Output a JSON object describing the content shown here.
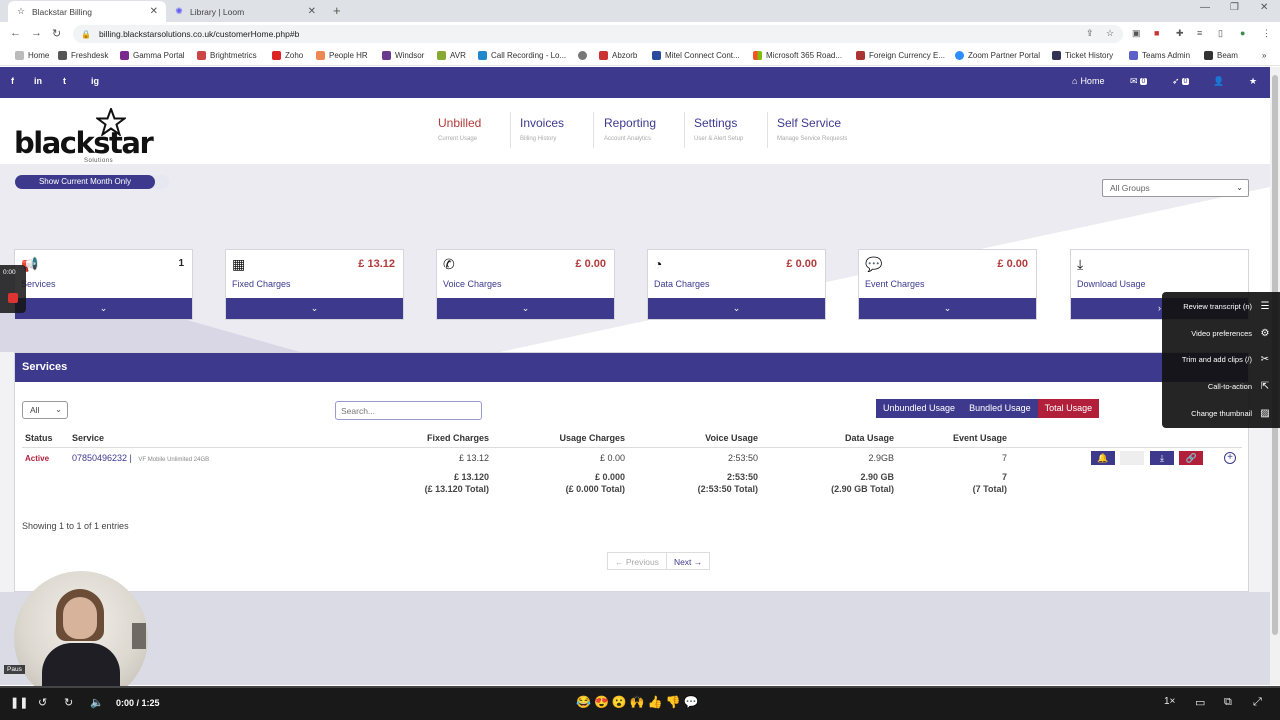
{
  "browser": {
    "tabs": [
      {
        "title": "Blackstar Billing",
        "active": true
      },
      {
        "title": "Library | Loom",
        "active": false
      }
    ],
    "url": "billing.blackstarsolutions.co.uk/customerHome.php#b",
    "bookmarks": [
      "Home",
      "Freshdesk",
      "Gamma Portal",
      "Brightmetrics",
      "Zoho",
      "People HR",
      "Windsor",
      "AVR",
      "Call Recording - Lo...",
      "Abzorb",
      "Mitel Connect Cont...",
      "Microsoft 365 Road...",
      "Foreign Currency E...",
      "Zoom Partner Portal",
      "Ticket History",
      "Teams Admin",
      "Beam"
    ]
  },
  "site": {
    "social": [
      "f",
      "in",
      "t",
      "ig"
    ],
    "top_right": {
      "home": "Home",
      "mail_count": "0",
      "rocket_count": "0"
    },
    "logo": {
      "name": "blackstar",
      "sub": "Solutions"
    },
    "nav": [
      {
        "label": "Unbilled",
        "sub": "Current Usage"
      },
      {
        "label": "Invoices",
        "sub": "Billing History"
      },
      {
        "label": "Reporting",
        "sub": "Account Analytics"
      },
      {
        "label": "Settings",
        "sub": "User & Alert Setup"
      },
      {
        "label": "Self Service",
        "sub": "Manage Service Requests"
      }
    ],
    "month_toggle": "Show Current Month Only",
    "groups_select": "All Groups",
    "cards": [
      {
        "label": "Services",
        "value": "1"
      },
      {
        "label": "Fixed Charges",
        "value": "£ 13.12"
      },
      {
        "label": "Voice Charges",
        "value": "£ 0.00"
      },
      {
        "label": "Data Charges",
        "value": "£ 0.00"
      },
      {
        "label": "Event Charges",
        "value": "£ 0.00"
      },
      {
        "label": "Download Usage",
        "value": ""
      }
    ],
    "services": {
      "title": "Services",
      "status_filter": "All",
      "search_placeholder": "Search...",
      "usage_toggle": [
        "Unbundled Usage",
        "Bundled Usage",
        "Total Usage"
      ],
      "usage_selected": "Total Usage",
      "columns": [
        "Status",
        "Service",
        "Fixed Charges",
        "Usage Charges",
        "Voice Usage",
        "Data Usage",
        "Event Usage"
      ],
      "rows": [
        {
          "status": "Active",
          "number": "07850496232 |",
          "desc": "VF Mobile Unlimited 24GB",
          "fixed": "£ 13.12",
          "usage": "£ 0.00",
          "voice": "2:53:50",
          "data": "2.9GB",
          "event": "7"
        }
      ],
      "totals": {
        "fixed": "£ 13.120",
        "fixed_total": "(£ 13.120 Total)",
        "usage": "£ 0.000",
        "usage_total": "(£ 0.000 Total)",
        "voice": "2:53:50",
        "voice_total": "(2:53:50 Total)",
        "data": "2.90 GB",
        "data_total": "(2.90 GB Total)",
        "event": "7",
        "event_total": "(7 Total)"
      },
      "entries": "Showing 1 to 1 of 1 entries",
      "prev": "← Previous",
      "next": "Next →"
    }
  },
  "loom": {
    "rec_time": "0:00",
    "menu": [
      "Review transcript (n)",
      "Video preferences",
      "Trim and add clips (/)",
      "Call-to-action",
      "Change thumbnail"
    ],
    "pause_tip": "Paus",
    "time": "0:00 / 1:25",
    "speed": "1×",
    "progress": 0.0
  },
  "colors": {
    "brand": "#3d3a8e",
    "accent_red": "#b21f3a"
  }
}
